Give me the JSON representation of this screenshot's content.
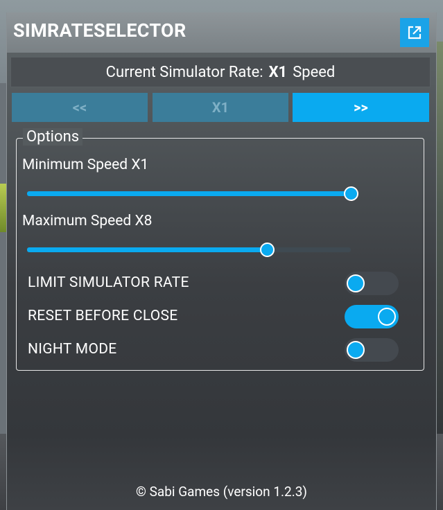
{
  "window": {
    "title": "SIMRATESELECTOR"
  },
  "rate_display": {
    "prefix": "Current Simulator Rate:",
    "value": "X1",
    "suffix": "Speed"
  },
  "rate_buttons": {
    "decrease_label": "<<",
    "current_label": "X1",
    "increase_label": ">>"
  },
  "options": {
    "legend": "Options",
    "min_speed": {
      "label": "Minimum Speed X1",
      "value_fraction": 1.0
    },
    "max_speed": {
      "label": "Maximum Speed X8",
      "value_fraction": 0.74
    },
    "toggles": [
      {
        "label": "LIMIT SIMULATOR RATE",
        "on": false
      },
      {
        "label": "RESET BEFORE CLOSE",
        "on": true
      },
      {
        "label": "NIGHT MODE",
        "on": false
      }
    ]
  },
  "footer": {
    "text": "© Sabi Games (version 1.2.3)"
  },
  "colors": {
    "accent": "#0aaaf0",
    "disabled_button": "#3b7d9a"
  },
  "icons": {
    "popout": "external-link-icon"
  }
}
